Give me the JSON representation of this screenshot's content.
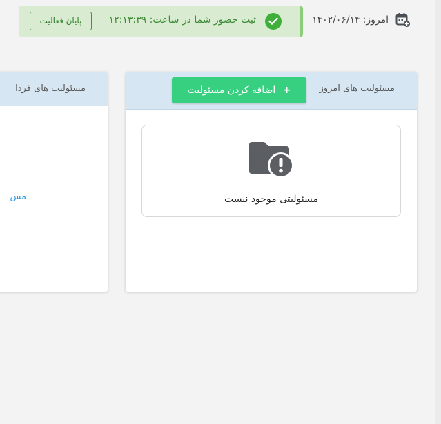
{
  "header": {
    "date_label": "امروز:",
    "date_value": "۱۴۰۲/۰۶/۱۴",
    "attendance_text": "ثبت حضور شما در ساعت: ۱۲:۱۳:۳۹",
    "end_activity_label": "پایان فعالیت"
  },
  "today_panel": {
    "title": "مسئولیت های امروز",
    "add_button_plus": "+",
    "add_button_label": "اضافه کردن مسئولیت",
    "empty_message": "مسئولیتی موجود نیست"
  },
  "tomorrow_panel": {
    "title": "مسئولیت های فردا",
    "link_text": "مس"
  },
  "icons": {
    "calendar": "calendar-plus-icon",
    "check": "check-circle-icon",
    "empty_folder": "folder-alert-icon"
  },
  "colors": {
    "success_bg": "#d9ecd2",
    "success_border": "#8ccd7a",
    "success_text": "#3c8a35",
    "add_button": "#37d080",
    "panel_header": "#d6e6f2",
    "link": "#2b9ae0"
  }
}
